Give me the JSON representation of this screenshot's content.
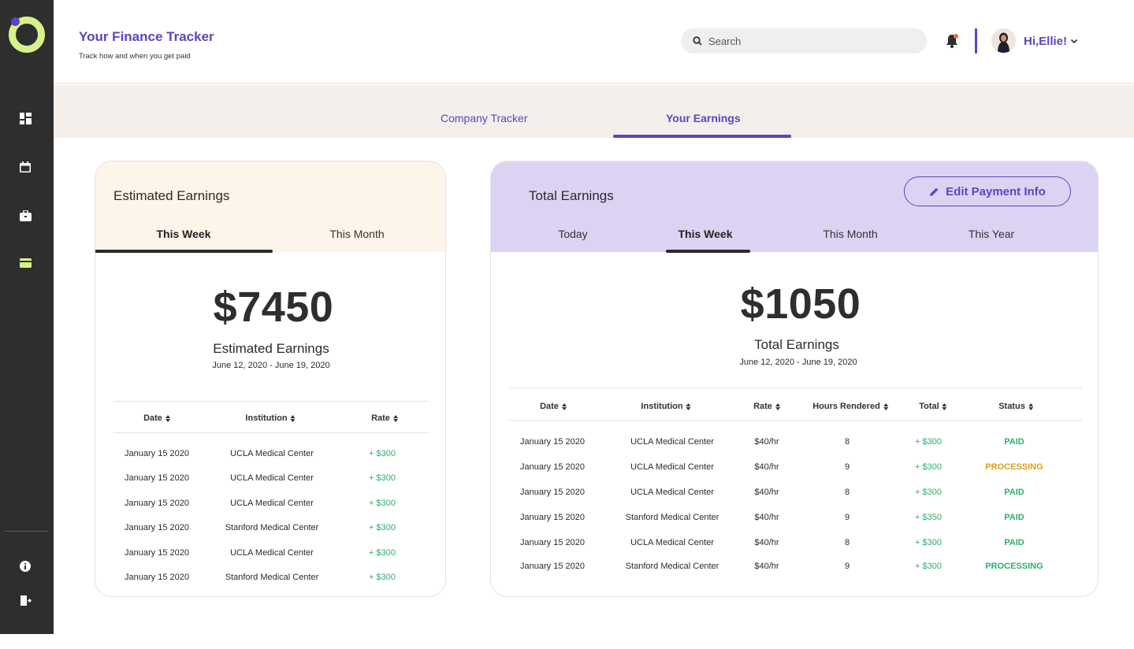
{
  "colors": {
    "brand": "#5b45c2",
    "sidebar": "#2e2e2e",
    "accent": "#d6f28a",
    "paid": "#2fae6a",
    "processing": "#d6a020",
    "processing_alt": "#2fae6a"
  },
  "sidebar": {
    "logo_icon": "ring-logo-icon",
    "items": [
      {
        "icon": "dashboard-icon"
      },
      {
        "icon": "calendar-icon"
      },
      {
        "icon": "briefcase-icon"
      },
      {
        "icon": "credit-card-icon",
        "active": true
      }
    ],
    "footer": [
      {
        "icon": "info-icon"
      },
      {
        "icon": "logout-icon"
      }
    ]
  },
  "header": {
    "title": "Your Finance Tracker",
    "subtitle": "Track how and when you get paid",
    "search_placeholder": "Search",
    "greeting": "Hi,Ellie!"
  },
  "tabs": [
    {
      "label": "Company Tracker",
      "active": false
    },
    {
      "label": "Your Earnings",
      "active": true
    }
  ],
  "estimated": {
    "title": "Estimated Earnings",
    "tabs": [
      {
        "label": "This Week",
        "active": true
      },
      {
        "label": "This Month",
        "active": false
      }
    ],
    "amount": "$7450",
    "label": "Estimated Earnings",
    "range": "June 12, 2020 - June 19, 2020",
    "columns": [
      "Date",
      "Institution",
      "Rate"
    ],
    "rows": [
      [
        "January 15 2020",
        "UCLA Medical Center",
        "+ $300"
      ],
      [
        "January 15 2020",
        "UCLA Medical Center",
        "+ $300"
      ],
      [
        "January 15 2020",
        "UCLA Medical Center",
        "+ $300"
      ],
      [
        "January 15 2020",
        "Stanford Medical Center",
        "+ $300"
      ],
      [
        "January 15 2020",
        "UCLA Medical Center",
        "+ $300"
      ],
      [
        "January 15 2020",
        "Stanford Medical Center",
        "+ $300"
      ]
    ]
  },
  "total": {
    "title": "Total Earnings",
    "edit_label": "Edit Payment Info",
    "tabs": [
      {
        "label": "Today",
        "active": false
      },
      {
        "label": "This Week",
        "active": true
      },
      {
        "label": "This Month",
        "active": false
      },
      {
        "label": "This Year",
        "active": false
      }
    ],
    "amount": "$1050",
    "label": "Total Earnings",
    "range": "June 12, 2020 - June 19, 2020",
    "columns": [
      "Date",
      "Institution",
      "Rate",
      "Hours Rendered",
      "Total",
      "Status"
    ],
    "rows": [
      [
        "January 15 2020",
        "UCLA Medical Center",
        "$40/hr",
        "8",
        "+ $300",
        "PAID"
      ],
      [
        "January 15 2020",
        "UCLA Medical Center",
        "$40/hr",
        "9",
        "+ $300",
        "PROCESSING"
      ],
      [
        "January 15 2020",
        "UCLA Medical Center",
        "$40/hr",
        "8",
        "+ $300",
        "PAID"
      ],
      [
        "January 15 2020",
        "Stanford Medical Center",
        "$40/hr",
        "9",
        "+ $350",
        "PAID"
      ],
      [
        "January 15 2020",
        "UCLA Medical Center",
        "$40/hr",
        "8",
        "+ $300",
        "PAID"
      ],
      [
        "January 15 2020",
        "Stanford Medical Center",
        "$40/hr",
        "9",
        "+ $300",
        "PROCESSING"
      ]
    ],
    "status_colors": [
      "#2fae6a",
      "#d6a020",
      "#2fae6a",
      "#2fae6a",
      "#2fae6a",
      "#2fae6a"
    ]
  }
}
